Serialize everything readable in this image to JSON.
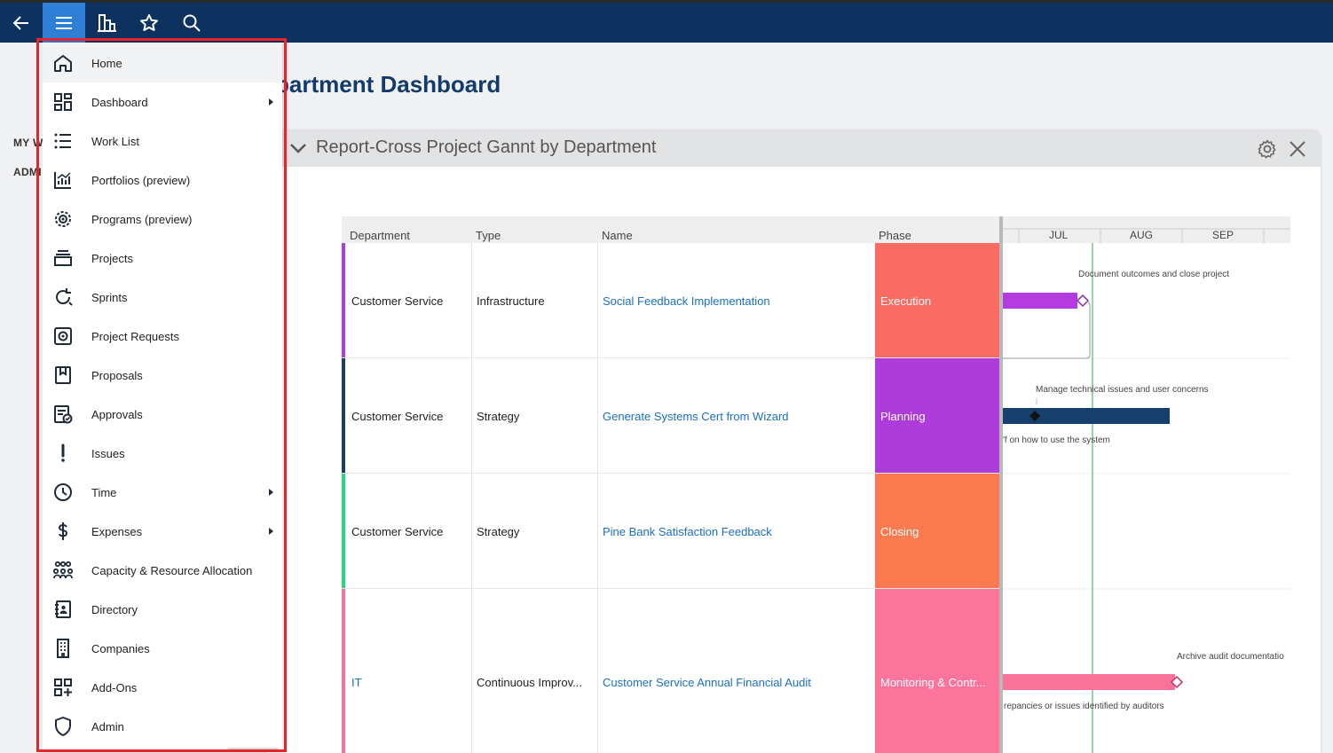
{
  "topbar": {
    "buttons": [
      {
        "name": "back-arrow-icon"
      },
      {
        "name": "hamburger-menu-icon"
      },
      {
        "name": "buildings-icon"
      },
      {
        "name": "star-icon"
      },
      {
        "name": "search-icon"
      }
    ]
  },
  "leftnav": {
    "items": [
      "MY W",
      "ADMI"
    ]
  },
  "page": {
    "title": "partment Dashboard"
  },
  "panel": {
    "title": "Report-Cross Project Gannt by Department",
    "grid": {
      "headers": {
        "department": "Department",
        "type": "Type",
        "name": "Name",
        "phase": "Phase"
      },
      "rows": [
        {
          "department": "Customer Service",
          "type": "Infrastructure",
          "name": "Social Feedback Implementation",
          "phase": "Execution",
          "bar_color": "#b33be0",
          "phase_color": "#fa6b63"
        },
        {
          "department": "Customer Service",
          "type": "Strategy",
          "name": "Generate Systems Cert from Wizard",
          "phase": "Planning",
          "bar_color": "#173f6d",
          "phase_color": "#ad3cda"
        },
        {
          "department": "Customer Service",
          "type": "Strategy",
          "name": "Pine Bank Satisfaction Feedback",
          "phase": "Closing",
          "bar_color": "#26d77b",
          "phase_color": "#fb7a4f"
        },
        {
          "department": "IT",
          "type": "Continuous Improv...",
          "name": "Customer Service Annual Financial Audit",
          "phase": "Monitoring & Contr...",
          "bar_color": "#f7739a",
          "phase_color": "#fb749b"
        }
      ]
    },
    "gantt": {
      "months": [
        "JUL",
        "AUG",
        "SEP"
      ],
      "labels": [
        "Document outcomes and close project",
        "Manage technical issues and user concerns",
        "'f on how to use the system",
        "Archive audit documentatio",
        "repancies or issues identified by auditors"
      ]
    }
  },
  "menu": {
    "items": [
      {
        "label": "Home",
        "icon": "home-icon",
        "submenu": false,
        "active": true
      },
      {
        "label": "Dashboard",
        "icon": "dashboard-icon",
        "submenu": true
      },
      {
        "label": "Work List",
        "icon": "list-icon",
        "submenu": false
      },
      {
        "label": "Portfolios (preview)",
        "icon": "chart-icon",
        "submenu": false
      },
      {
        "label": "Programs (preview)",
        "icon": "gear-cluster-icon",
        "submenu": false
      },
      {
        "label": "Projects",
        "icon": "stack-icon",
        "submenu": false
      },
      {
        "label": "Sprints",
        "icon": "sprint-cycle-icon",
        "submenu": false
      },
      {
        "label": "Project Requests",
        "icon": "request-icon",
        "submenu": false
      },
      {
        "label": "Proposals",
        "icon": "bookmark-icon",
        "submenu": false
      },
      {
        "label": "Approvals",
        "icon": "approval-icon",
        "submenu": false
      },
      {
        "label": "Issues",
        "icon": "exclamation-icon",
        "submenu": false
      },
      {
        "label": "Time",
        "icon": "clock-icon",
        "submenu": true
      },
      {
        "label": "Expenses",
        "icon": "dollar-icon",
        "submenu": true
      },
      {
        "label": "Capacity & Resource Allocation",
        "icon": "people-group-icon",
        "submenu": false
      },
      {
        "label": "Directory",
        "icon": "contact-book-icon",
        "submenu": false
      },
      {
        "label": "Companies",
        "icon": "building-icon",
        "submenu": false
      },
      {
        "label": "Add-Ons",
        "icon": "add-ons-icon",
        "submenu": false
      },
      {
        "label": "Admin",
        "icon": "shield-icon",
        "submenu": false
      }
    ]
  }
}
